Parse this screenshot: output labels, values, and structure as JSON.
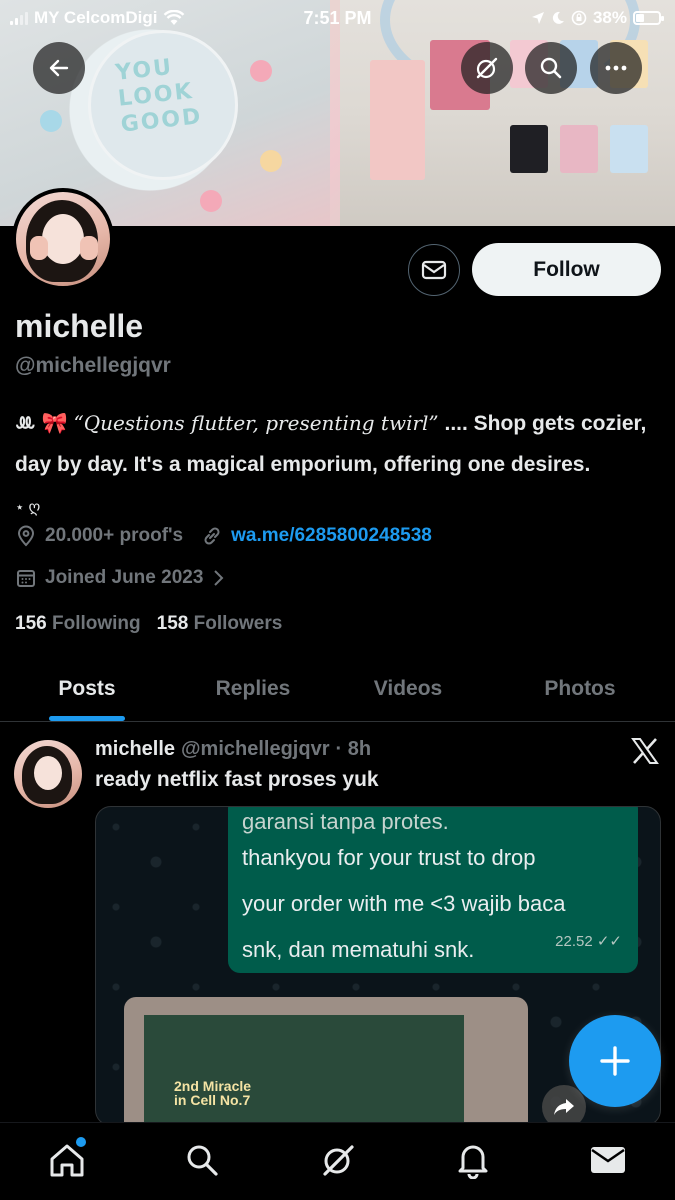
{
  "status_bar": {
    "carrier": "MY CelcomDigi",
    "time": "7:51 PM",
    "battery": "38%",
    "battery_level": 0.38
  },
  "banner": {
    "mirror_text": "YOU LOOK GOOD"
  },
  "profile": {
    "name": "michelle",
    "handle": "@michellegjqvr",
    "bio_prefix": "ꔛ 🎀 ",
    "bio_quote": "“Questions flutter, presenting twirl”",
    "bio_rest": " .... Shop gets cozier, day by day. It's a magical emporium, offering one desires.",
    "bio_suffix": "⋆ ღ",
    "location": "20.000+ proof's",
    "link": "wa.me/6285800248538",
    "joined": "Joined June 2023",
    "following_count": "156",
    "following_label": "Following",
    "followers_count": "158",
    "followers_label": "Followers",
    "follow_button": "Follow"
  },
  "tabs": [
    {
      "label": "Posts",
      "active": true
    },
    {
      "label": "Replies",
      "active": false
    },
    {
      "label": "Videos",
      "active": false
    },
    {
      "label": "Photos",
      "active": false
    }
  ],
  "post": {
    "name": "michelle",
    "handle": "@michellegjqvr",
    "age": "· 8h",
    "text": "ready netflix fast proses yuk",
    "media": {
      "line0": "garansi tanpa protes.",
      "line1": "thankyou for your trust to drop",
      "line2": "your order with me <3 wajib baca",
      "line3": "snk, dan mematuhi snk.",
      "time": "22.52 ✓✓",
      "tv_title_1": "2nd Miracle",
      "tv_title_2": "in Cell No.7"
    }
  },
  "bottom_nav": [
    "home-icon",
    "search-icon",
    "grok-icon",
    "bell-icon",
    "mail-icon"
  ],
  "colors": {
    "accent": "#1d9bf0",
    "background": "#000000",
    "muted": "#71767b",
    "bubble": "#005c4b"
  }
}
